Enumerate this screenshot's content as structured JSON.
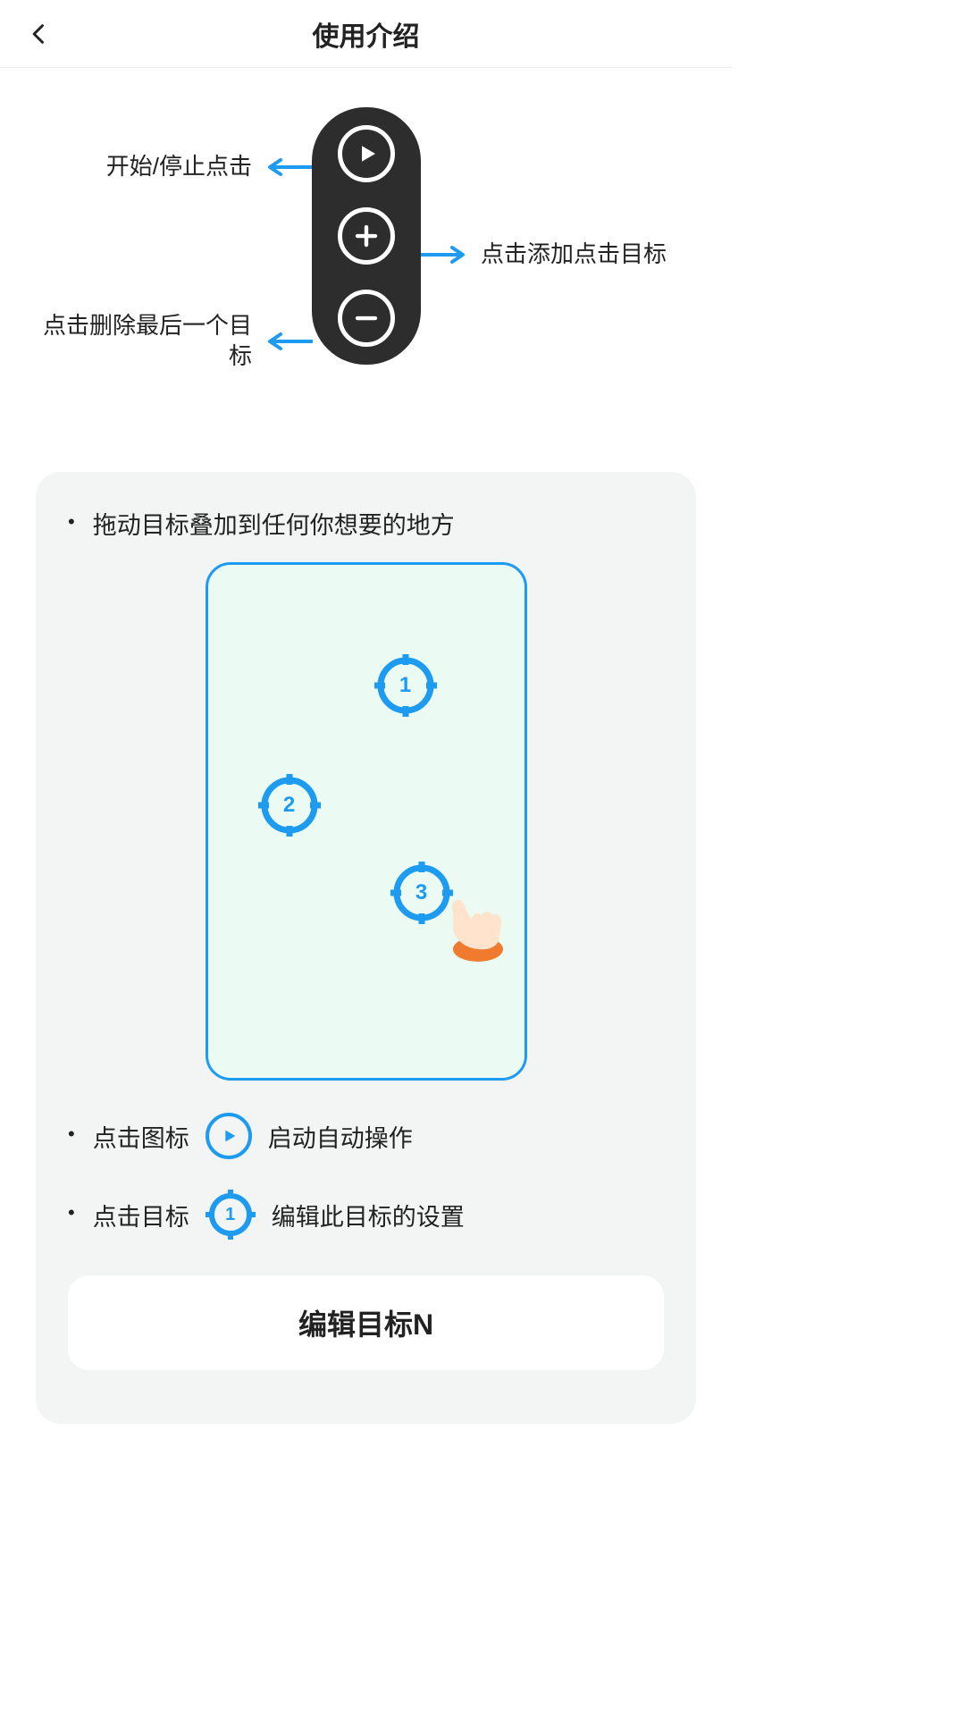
{
  "header": {
    "title": "使用介绍"
  },
  "panel": {
    "label_play": "开始/停止点击",
    "label_add": "点击添加点击目标",
    "label_remove": "点击删除最后一个目标"
  },
  "card": {
    "drag_hint": "拖动目标叠加到任何你想要的地方",
    "targets": {
      "t1": "1",
      "t2": "2",
      "t3": "3"
    },
    "play_line_before": "点击图标",
    "play_line_after": "启动自动操作",
    "edit_line_before": "点击目标",
    "edit_line_after": "编辑此目标的设置",
    "inline_crosshair_num": "1",
    "edit_card_title": "编辑目标N"
  }
}
